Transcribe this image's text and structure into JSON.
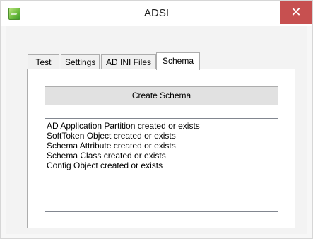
{
  "window": {
    "title": "ADSI",
    "close_glyph": "✕"
  },
  "tabs": [
    {
      "label": "Test"
    },
    {
      "label": "Settings"
    },
    {
      "label": "AD INI Files"
    },
    {
      "label": "Schema"
    }
  ],
  "active_tab": "Schema",
  "schema": {
    "create_button_label": "Create Schema",
    "log_items": [
      "AD Application Partition created or exists",
      "SoftToken Object created or exists",
      "Schema Attribute created or exists",
      "Schema Class created or exists",
      "Config Object created or exists"
    ]
  },
  "colors": {
    "close_button": "#c75050",
    "app_icon": "#6fbd3f"
  }
}
